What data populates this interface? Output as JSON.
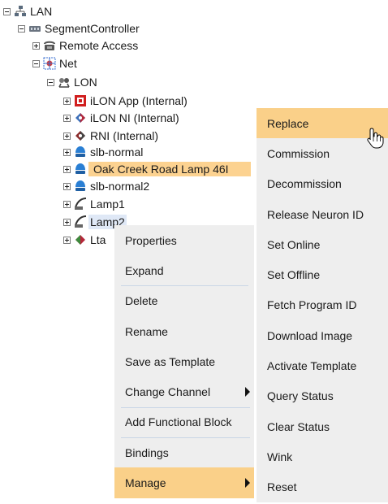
{
  "tree": {
    "lan": "LAN",
    "segment_controller": "SegmentController",
    "remote_access": "Remote Access",
    "net": "Net",
    "lon": "LON",
    "ilon_app": "iLON App (Internal)",
    "ilon_ni": "iLON NI (Internal)",
    "rni": "RNI (Internal)",
    "slb_normal": "slb-normal",
    "oak_creek": "Oak Creek Road Lamp 46I",
    "slb_normal2": "slb-normal2",
    "lamp1": "Lamp1",
    "lamp2": "Lamp2",
    "lta": "Lta"
  },
  "context_menu": {
    "items": [
      "Properties",
      "Expand",
      "Delete",
      "Rename",
      "Save as Template",
      "Change Channel",
      "Add Functional Block",
      "Bindings",
      "Manage"
    ]
  },
  "manage_submenu": {
    "items": [
      "Replace",
      "Commission",
      "Decommission",
      "Release Neuron ID",
      "Set Online",
      "Set Offline",
      "Fetch Program ID",
      "Download Image",
      "Activate Template",
      "Query Status",
      "Clear Status",
      "Wink",
      "Reset"
    ]
  },
  "colors": {
    "selection": "#fcd290",
    "menu_active": "#fad089",
    "menu_bg": "#eeeeee",
    "lamp2_highlight": "#dfe8f6"
  }
}
